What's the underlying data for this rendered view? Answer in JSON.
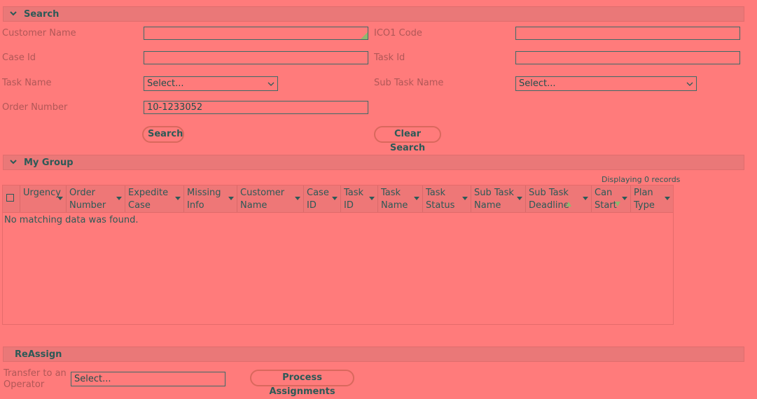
{
  "search": {
    "title": "Search",
    "customer_name_label": "Customer Name",
    "ico1_code_label": "ICO1 Code",
    "case_id_label": "Case Id",
    "task_id_label": "Task Id",
    "task_name_label": "Task Name",
    "task_name_value": "Select...",
    "sub_task_name_label": "Sub Task Name",
    "sub_task_name_value": "Select...",
    "order_number_label": "Order Number",
    "order_number_value": "10-1233052",
    "search_button": "Search",
    "clear_button": "Clear Search"
  },
  "my_group": {
    "title": "My Group",
    "records": "Displaying 0 records",
    "empty_message": "No matching data was found.",
    "columns": [
      "Urgency",
      "Order\nNumber",
      "Expedite\nCase",
      "Missing\nInfo",
      "Customer\nName",
      "Case\nID",
      "Task\nID",
      "Task\nName",
      "Task\nStatus",
      "Sub Task\nName",
      "Sub Task\nDeadline",
      "Can\nStart",
      "Plan\nType"
    ]
  },
  "reassign": {
    "title": "ReAssign",
    "transfer_label": "Transfer to an\nOperator",
    "transfer_value": "Select...",
    "process_button": "Process Assignments"
  }
}
